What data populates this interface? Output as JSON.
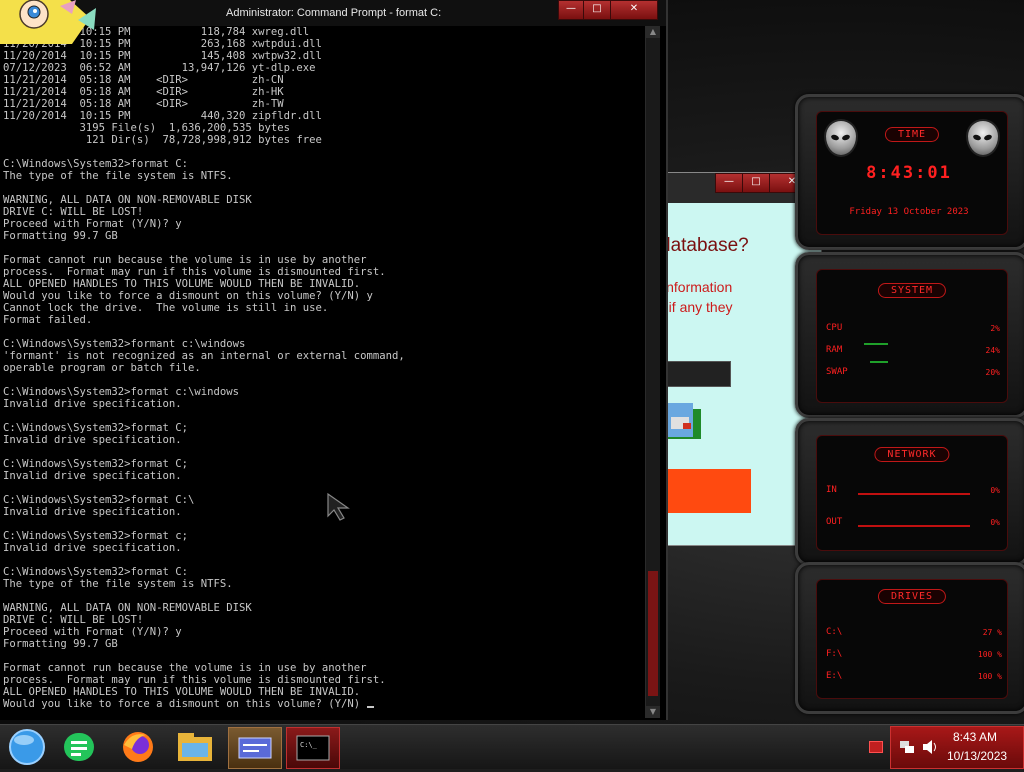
{
  "cmd": {
    "title": "Administrator: Command Prompt - format  C:",
    "minimize": "—",
    "maximize": "□",
    "close": "✕",
    "lines": [
      "11/20/2014  10:15 PM           118,784 xwreg.dll",
      "11/20/2014  10:15 PM           263,168 xwtpdui.dll",
      "11/20/2014  10:15 PM           145,408 xwtpw32.dll",
      "07/12/2023  06:52 AM        13,947,126 yt-dlp.exe",
      "11/21/2014  05:18 AM    <DIR>          zh-CN",
      "11/21/2014  05:18 AM    <DIR>          zh-HK",
      "11/21/2014  05:18 AM    <DIR>          zh-TW",
      "11/20/2014  10:15 PM           440,320 zipfldr.dll",
      "            3195 File(s)  1,636,200,535 bytes",
      "             121 Dir(s)  78,728,998,912 bytes free",
      "",
      "C:\\Windows\\System32>format C:",
      "The type of the file system is NTFS.",
      "",
      "WARNING, ALL DATA ON NON-REMOVABLE DISK",
      "DRIVE C: WILL BE LOST!",
      "Proceed with Format (Y/N)? y",
      "Formatting 99.7 GB",
      "",
      "Format cannot run because the volume is in use by another",
      "process.  Format may run if this volume is dismounted first.",
      "ALL OPENED HANDLES TO THIS VOLUME WOULD THEN BE INVALID.",
      "Would you like to force a dismount on this volume? (Y/N) y",
      "Cannot lock the drive.  The volume is still in use.",
      "Format failed.",
      "",
      "C:\\Windows\\System32>formant c:\\windows",
      "'formant' is not recognized as an internal or external command,",
      "operable program or batch file.",
      "",
      "C:\\Windows\\System32>format c:\\windows",
      "Invalid drive specification.",
      "",
      "C:\\Windows\\System32>format C;",
      "Invalid drive specification.",
      "",
      "C:\\Windows\\System32>format C;",
      "Invalid drive specification.",
      "",
      "C:\\Windows\\System32>format C:\\",
      "Invalid drive specification.",
      "",
      "C:\\Windows\\System32>format c;",
      "Invalid drive specification.",
      "",
      "C:\\Windows\\System32>format C:",
      "The type of the file system is NTFS.",
      "",
      "WARNING, ALL DATA ON NON-REMOVABLE DISK",
      "DRIVE C: WILL BE LOST!",
      "Proceed with Format (Y/N)? y",
      "Formatting 99.7 GB",
      "",
      "Format cannot run because the volume is in use by another",
      "process.  Format may run if this volume is dismounted first.",
      "ALL OPENED HANDLES TO THIS VOLUME WOULD THEN BE INVALID.",
      "Would you like to force a dismount on this volume? (Y/N) "
    ]
  },
  "dialog": {
    "heading": "database?",
    "info1": "information",
    "info2": "e if any they"
  },
  "gadgets": {
    "time": {
      "title": "TIME",
      "clock": "8:43:01",
      "date": "Friday 13 October 2023"
    },
    "system": {
      "title": "SYSTEM",
      "rows": [
        {
          "label": "CPU",
          "value": "2%"
        },
        {
          "label": "RAM",
          "value": "24%"
        },
        {
          "label": "SWAP",
          "value": "20%"
        }
      ]
    },
    "network": {
      "title": "NETWORK",
      "rows": [
        {
          "label": "IN",
          "value": "0%"
        },
        {
          "label": "OUT",
          "value": "0%"
        }
      ]
    },
    "drives": {
      "title": "DRIVES",
      "rows": [
        {
          "label": "C:\\",
          "value": "27 %",
          "fill": 0.27
        },
        {
          "label": "F:\\",
          "value": "100 %",
          "fill": 1.0
        },
        {
          "label": "E:\\",
          "value": "100 %",
          "fill": 1.0
        }
      ]
    }
  },
  "taskbar": {
    "apps": [
      "start-orb",
      "notes-app",
      "firefox",
      "file-explorer",
      "media-app",
      "command-prompt"
    ],
    "time": "8:43 AM",
    "date": "10/13/2023"
  },
  "colors": {
    "accent_red": "#ff2020",
    "console_text": "#c8c8c8",
    "dialog_bg": "#ccf7f2",
    "dialog_button": "#ff4a10"
  }
}
